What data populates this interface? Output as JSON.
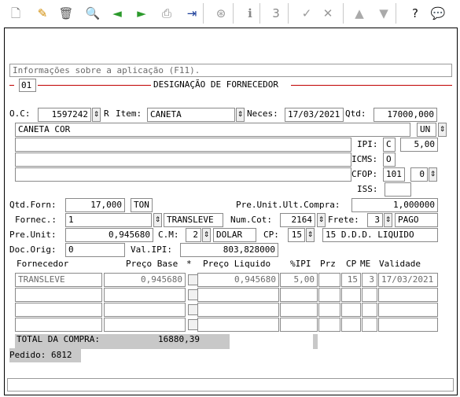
{
  "toolbar": {
    "buttons": [
      {
        "name": "new-document-icon",
        "glyph": "🗋",
        "color": "#7a7a7a"
      },
      {
        "name": "edit-pencil-icon",
        "glyph": "✎",
        "color": "#d08a00"
      },
      {
        "name": "trash-icon",
        "glyph": "🗑",
        "color": "#555555"
      },
      {
        "name": "search-icon",
        "glyph": "🔍",
        "color": "#1d5fbf"
      },
      {
        "name": "back-arrow-icon",
        "glyph": "◄",
        "color": "#2c9a2c"
      },
      {
        "name": "forward-arrow-icon",
        "glyph": "►",
        "color": "#2c9a2c"
      },
      {
        "name": "print-icon",
        "glyph": "⎙",
        "color": "#888888"
      },
      {
        "name": "exit-door-icon",
        "glyph": "⇥",
        "color": "#1d3f9a"
      },
      {
        "name": "binoculars-icon",
        "glyph": "⊛",
        "color": "#999999"
      },
      {
        "name": "info-icon",
        "glyph": "ℹ",
        "color": "#888888"
      },
      {
        "name": "number-icon",
        "glyph": "3",
        "color": "#888888"
      },
      {
        "name": "confirm-check-icon",
        "glyph": "✓",
        "color": "#999999"
      },
      {
        "name": "cancel-tools-icon",
        "glyph": "✕",
        "color": "#999999"
      },
      {
        "name": "arrow-up-icon",
        "glyph": "▲",
        "color": "#aaaaaa"
      },
      {
        "name": "arrow-down-icon",
        "glyph": "▼",
        "color": "#aaaaaa"
      },
      {
        "name": "help-icon",
        "glyph": "?",
        "color": "#111111"
      },
      {
        "name": "comment-bubble-icon",
        "glyph": "💬",
        "color": "#555555"
      }
    ]
  },
  "info_bar": "Informações sobre a aplicação (F11).",
  "designation": {
    "number": "01",
    "title": "DESIGNAÇÃO DE FORNECEDOR"
  },
  "order": {
    "oc_label": "O.C:",
    "oc_value": "1597242",
    "oc_suffix": "R",
    "item_label": "Item:",
    "item_value": "CANETA",
    "neces_label": "Neces:",
    "neces_value": "17/03/2021",
    "qtd_label": "Qtd:",
    "qtd_value": "17000,000",
    "description": "CANETA COR",
    "unit": "UN",
    "ipi_label": "IPI:",
    "ipi_code": "C",
    "ipi_value": "5,00",
    "icms_label": "ICMS:",
    "icms_value": "O",
    "cfop_label": "CFOP:",
    "cfop_value": "101",
    "cfop_sub": "0",
    "iss_label": "ISS:",
    "iss_value": ""
  },
  "supplier": {
    "qtd_forn_label": "Qtd.Forn:",
    "qtd_forn_value": "17,000",
    "qtd_forn_unit": "TON",
    "pre_unit_ult_label": "Pre.Unit.Ult.Compra:",
    "pre_unit_ult_value": "1,000000",
    "fornec_label": "Fornec.:",
    "fornec_value": "1",
    "fornec_name": "TRANSLEVE",
    "num_cot_label": "Num.Cot:",
    "num_cot_value": "2164",
    "frete_label": "Frete:",
    "frete_value": "3",
    "frete_desc": "PAGO",
    "pre_unit_label": "Pre.Unit:",
    "pre_unit_value": "0,945680",
    "cm_label": "C.M:",
    "cm_value": "2",
    "cm_desc": "DOLAR",
    "cp_label": "CP:",
    "cp_value": "15",
    "cp_desc": "15 D.D.D. LIQUIDO",
    "doc_orig_label": "Doc.Orig:",
    "doc_orig_value": "0",
    "val_ipi_label": "Val.IPI:",
    "val_ipi_value": "803,828000"
  },
  "grid": {
    "headers": [
      "Fornecedor",
      "Preço Base",
      "*",
      "Preço Liquido",
      "%IPI",
      "Prz",
      "CP",
      "ME",
      "Validade"
    ],
    "rows": [
      [
        "TRANSLEVE",
        "0,945680",
        "",
        "0,945680",
        "5,00",
        "",
        "15",
        "3",
        "17/03/2021"
      ],
      [
        "",
        "",
        "",
        "",
        "",
        "",
        "",
        "",
        ""
      ],
      [
        "",
        "",
        "",
        "",
        "",
        "",
        "",
        "",
        ""
      ],
      [
        "",
        "",
        "",
        "",
        "",
        "",
        "",
        "",
        ""
      ]
    ]
  },
  "totals": {
    "total_label": "TOTAL DA COMPRA:",
    "total_value": "16880,39"
  },
  "pedido": "Pedido: 6812",
  "status_bar": ""
}
